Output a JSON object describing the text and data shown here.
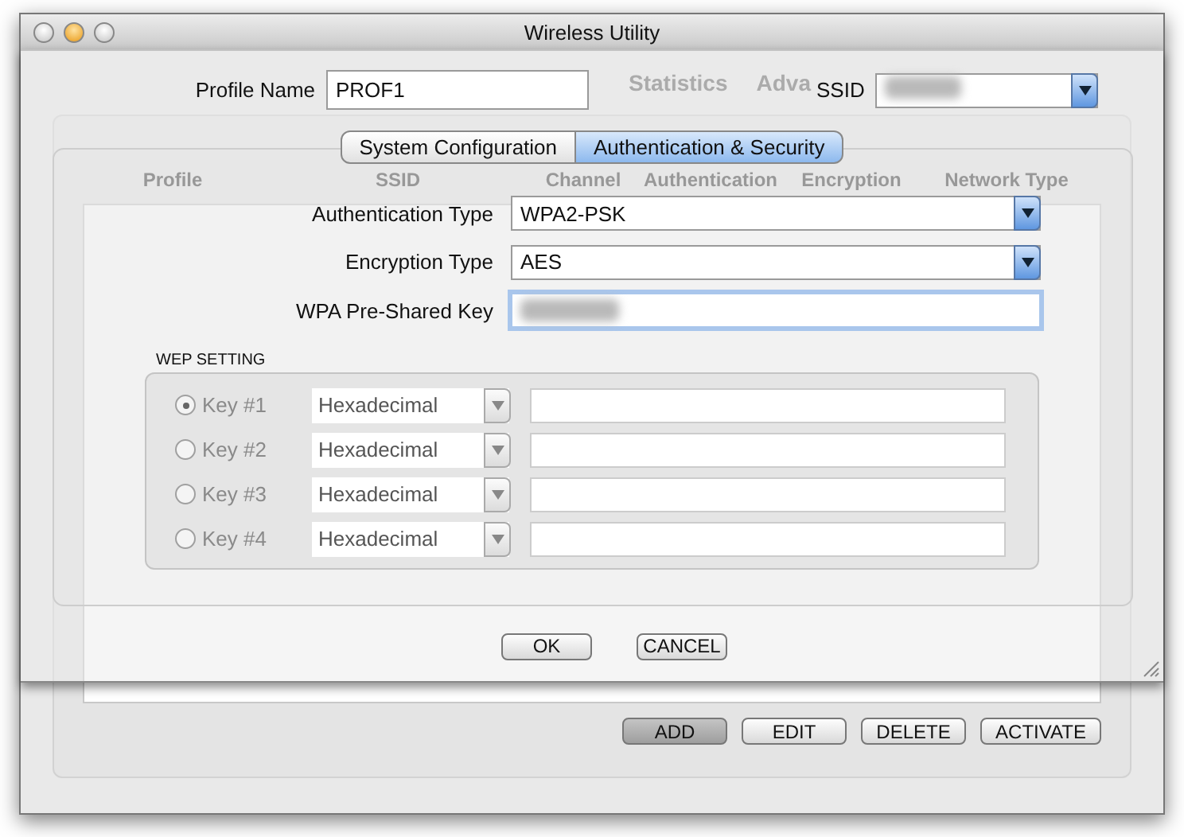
{
  "window": {
    "title": "Wireless Utility"
  },
  "background": {
    "tabs": [
      {
        "label": "Statistics"
      },
      {
        "label": "Adva"
      }
    ],
    "table": {
      "columns": [
        "Profile",
        "SSID",
        "Channel",
        "Authentication",
        "Encryption",
        "Network Type"
      ]
    },
    "buttons": [
      {
        "label": "ADD",
        "selected": true
      },
      {
        "label": "EDIT",
        "selected": false
      },
      {
        "label": "DELETE",
        "selected": false
      },
      {
        "label": "ACTIVATE",
        "selected": false
      }
    ]
  },
  "sheet": {
    "profile_name": {
      "label": "Profile Name",
      "value": "PROF1"
    },
    "ssid": {
      "label": "SSID",
      "masked": true
    },
    "tabs": [
      {
        "label": "System Configuration",
        "selected": false
      },
      {
        "label": "Authentication & Security",
        "selected": true
      }
    ],
    "fields": [
      {
        "label": "Authentication Type",
        "kind": "select",
        "value": "WPA2-PSK"
      },
      {
        "label": "Encryption Type",
        "kind": "select",
        "value": "AES"
      },
      {
        "label": "WPA Pre-Shared Key",
        "kind": "masked",
        "focused": true
      }
    ],
    "wep": {
      "title": "WEP SETTING",
      "disabled": true,
      "keys": [
        {
          "label": "Key #1",
          "selected": true,
          "format": "Hexadecimal"
        },
        {
          "label": "Key #2",
          "selected": false,
          "format": "Hexadecimal"
        },
        {
          "label": "Key #3",
          "selected": false,
          "format": "Hexadecimal"
        },
        {
          "label": "Key #4",
          "selected": false,
          "format": "Hexadecimal"
        }
      ]
    },
    "buttons": [
      "OK",
      "CANCEL"
    ]
  }
}
